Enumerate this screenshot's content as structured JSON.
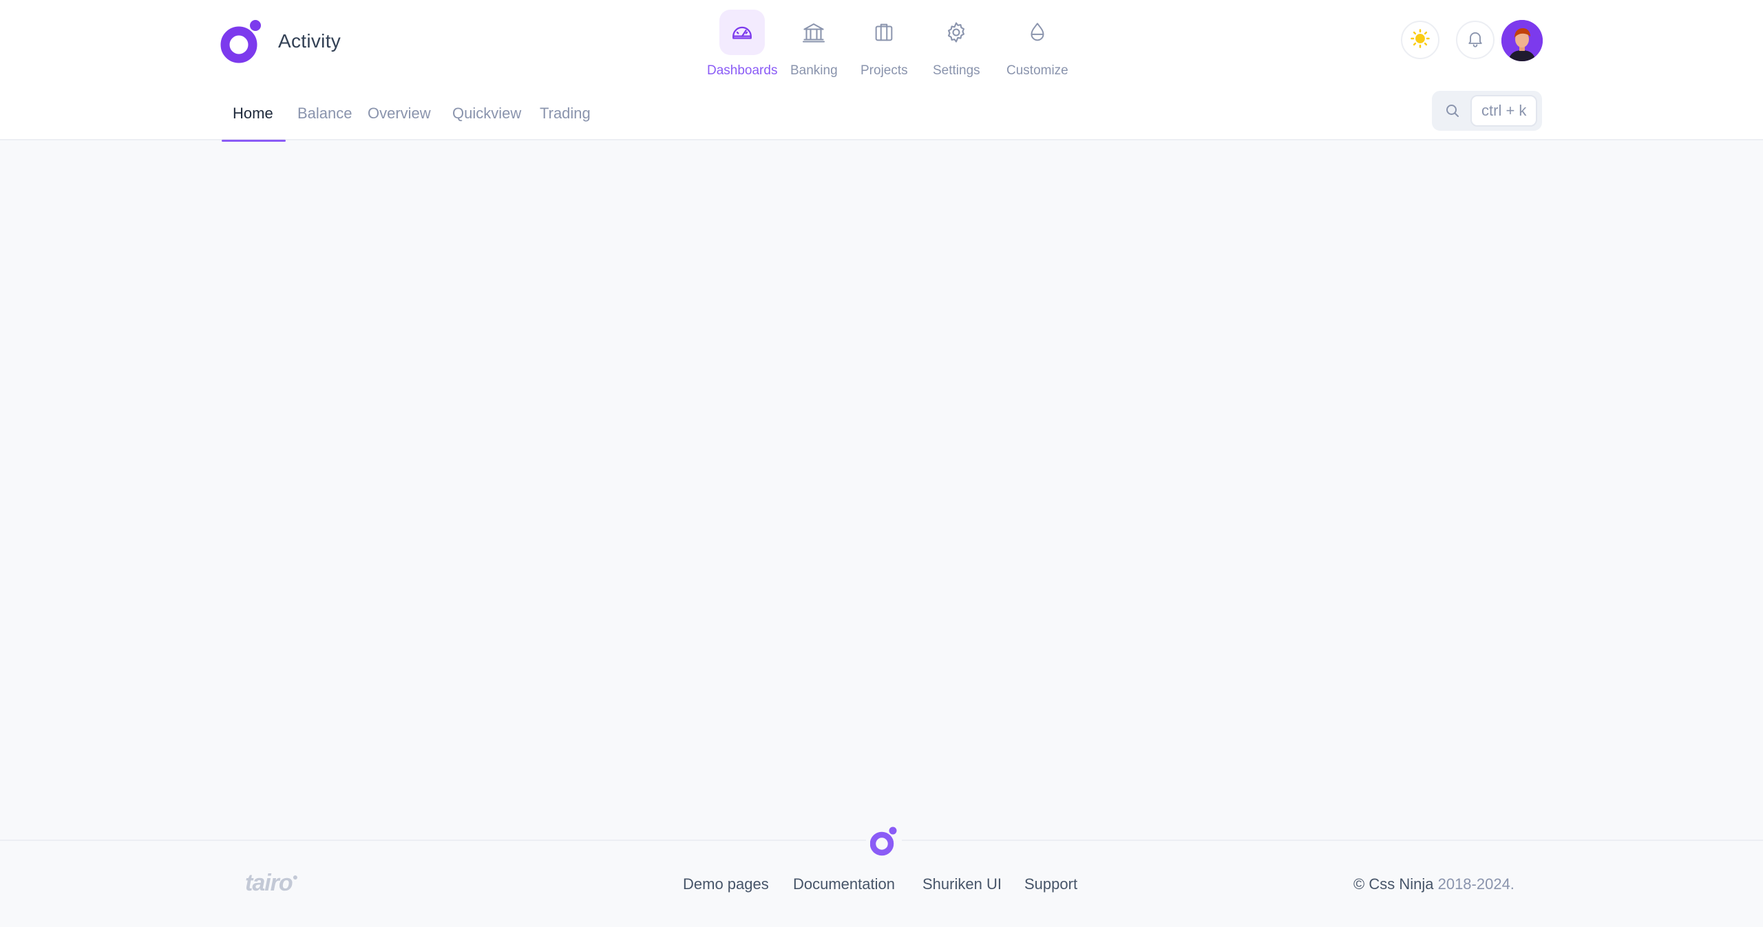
{
  "brand": {
    "title": "Activity",
    "accent": "#7c3aed"
  },
  "topnav": {
    "items": [
      {
        "label": "Dashboards",
        "icon": "gauge-icon",
        "active": true
      },
      {
        "label": "Banking",
        "icon": "bank-icon",
        "active": false
      },
      {
        "label": "Projects",
        "icon": "briefcase-icon",
        "active": false
      },
      {
        "label": "Settings",
        "icon": "gear-icon",
        "active": false
      },
      {
        "label": "Customize",
        "icon": "drop-icon",
        "active": false
      }
    ]
  },
  "actions": {
    "theme_icon": "sun-icon",
    "notifications_icon": "bell-icon",
    "avatar_icon": "user-avatar"
  },
  "subnav": {
    "items": [
      {
        "label": "Home",
        "active": true
      },
      {
        "label": "Balance",
        "active": false
      },
      {
        "label": "Overview",
        "active": false
      },
      {
        "label": "Quickview",
        "active": false
      },
      {
        "label": "Trading",
        "active": false
      }
    ]
  },
  "search": {
    "shortcut": "ctrl + k"
  },
  "footer": {
    "wordmark": "tairo",
    "links": [
      "Demo pages",
      "Documentation",
      "Shuriken UI",
      "Support"
    ],
    "copyright_owner": "© Css Ninja",
    "copyright_years": "2018-2024."
  }
}
